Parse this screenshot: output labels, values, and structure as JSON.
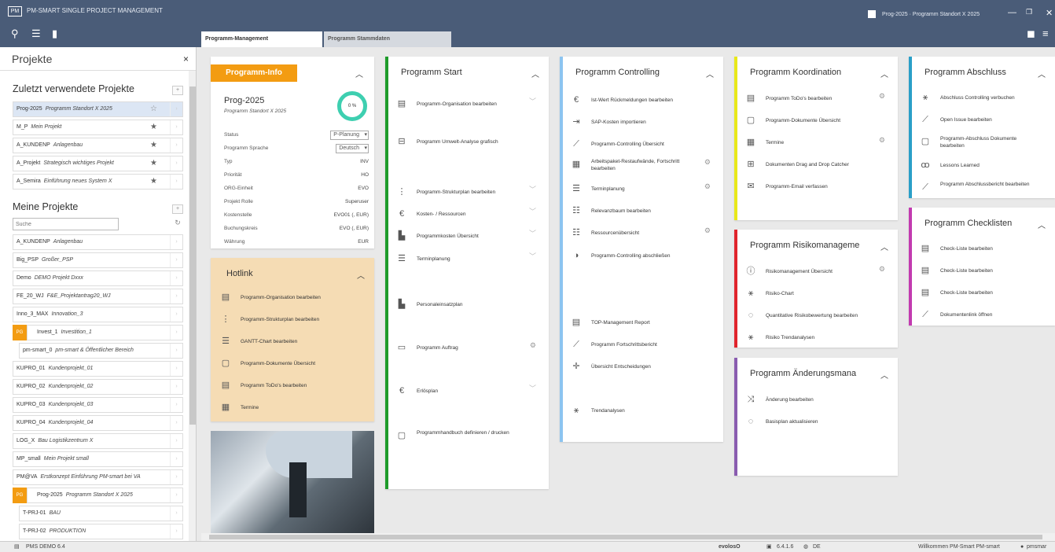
{
  "app": {
    "logo": "PM",
    "title": "PM-SMART SINGLE PROJECT MANAGEMENT",
    "current_project": "Prog-2025 · Programm Standort X 2025",
    "win_min": "—",
    "win_restore": "❐",
    "win_close": "✕"
  },
  "tabs": [
    {
      "label": "Programm-Management"
    },
    {
      "label": "Programm Stammdaten"
    }
  ],
  "sidebar": {
    "title": "Projekte",
    "close": "×",
    "recent_title": "Zuletzt verwendete Projekte",
    "recent": [
      {
        "code": "Prog-2025",
        "name": "Programm Standort X 2025"
      },
      {
        "code": "M_P",
        "name": "Mein Projekt"
      },
      {
        "code": "A_KUNDENP",
        "name": "Anlagenbau"
      },
      {
        "code": "A_Projekt",
        "name": "Strategisch wichtiges Projekt"
      },
      {
        "code": "A_Semira",
        "name": "Einführung neues System X"
      }
    ],
    "mine_title": "Meine Projekte",
    "search_placeholder": "Suche",
    "mine": [
      {
        "code": "A_KUNDENP",
        "name": "Anlagenbau"
      },
      {
        "code": "Big_PSP",
        "name": "Großer_PSP"
      },
      {
        "code": "Demo",
        "name": "DEMO Projekt Dxxx"
      },
      {
        "code": "FE_20_WJ",
        "name": "F&E_Projektantrag20_WJ"
      },
      {
        "code": "Inno_3_MAX",
        "name": "Innovation_3"
      },
      {
        "code": "Invest_1",
        "name": "Investition_1"
      },
      {
        "code": "pm-smart_0",
        "name": "pm-smart & Öffentlicher Bereich"
      },
      {
        "code": "KUPRO_01",
        "name": "Kundenprojekt_01"
      },
      {
        "code": "KUPRO_02",
        "name": "Kundenprojekt_02"
      },
      {
        "code": "KUPRO_03",
        "name": "Kundenprojekt_03"
      },
      {
        "code": "KUPRO_04",
        "name": "Kundenprojekt_04"
      },
      {
        "code": "LOG_X",
        "name": "Bau Logistikzentrum X"
      },
      {
        "code": "MP_small",
        "name": "Mein Projekt small"
      },
      {
        "code": "PM@VA",
        "name": "Erstkonzept Einführung PM-smart bei VA"
      },
      {
        "code": "Prog-2025",
        "name": "Programm Standort X 2025"
      },
      {
        "code": "T-PRJ-01",
        "name": "BAU"
      },
      {
        "code": "T-PRJ-02",
        "name": "PRODUKTION"
      }
    ],
    "flag": "PG"
  },
  "info": {
    "banner": "Programm-Info",
    "code": "Prog-2025",
    "name": "Programm Standort X 2025",
    "percent": "0 %",
    "fields": [
      {
        "k": "Status",
        "v": "P-Planung"
      },
      {
        "k": "Programm Sprache",
        "v": "Deutsch"
      },
      {
        "k": "Typ",
        "v": "INV"
      },
      {
        "k": "Priorität",
        "v": "HO"
      },
      {
        "k": "ORG-Einheit",
        "v": "EVO"
      },
      {
        "k": "Projekt Rolle",
        "v": "Superuser"
      },
      {
        "k": "Kostenstelle",
        "v": "EVO01 (, EUR)"
      },
      {
        "k": "Buchungskreis",
        "v": "EVO (, EUR)"
      },
      {
        "k": "Währung",
        "v": "EUR"
      }
    ]
  },
  "hotlink": {
    "title": "Hotlink",
    "items": [
      "Programm-Organisation bearbeiten",
      "Programm-Strukturplan bearbeiten",
      "GANTT-Chart bearbeiten",
      "Programm-Dokumente Übersicht",
      "Programm ToDo's bearbeiten",
      "Termine"
    ]
  },
  "start": {
    "title": "Programm Start",
    "items": [
      "Programm-Organisation bearbeiten",
      "Programm Umwelt-Analyse grafisch",
      "Programm-Strukturplan bearbeiten",
      "Kosten- / Ressourcen",
      "Programmkosten Übersicht",
      "Terminplanung",
      "Personaleinsatzplan",
      "Programm Auftrag",
      "Erlösplan",
      "Programmhandbuch definieren / drucken"
    ]
  },
  "controlling": {
    "title": "Programm Controlling",
    "items": [
      "Ist-Wert Rückmeldungen bearbeiten",
      "SAP-Kosten importieren",
      "Programm-Controlling Übersicht",
      "Arbeitspaket-Restaufwände, Fortschritt bearbeiten",
      "Terminplanung",
      "Relevanzbaum bearbeiten",
      "Ressourcenübersicht",
      "Programm-Controlling abschließen",
      "TOP-Management Report",
      "Programm Fortschrittsbericht",
      "Übersicht Entscheidungen",
      "Trendanalysen"
    ]
  },
  "koordination": {
    "title": "Programm Koordination",
    "items": [
      "Programm ToDo's bearbeiten",
      "Programm-Dokumente Übersicht",
      "Termine",
      "Dokumenten Drag and Drop Catcher",
      "Programm-Email verfassen"
    ]
  },
  "risiko": {
    "title": "Programm Risikomanageme",
    "items": [
      "Risikomanagement Übersicht",
      "Risiko-Chart",
      "Quantitative Risikobewertung bearbeiten",
      "Risiko Trendanalysen"
    ]
  },
  "aenderung": {
    "title": "Programm Änderungsmana",
    "items": [
      "Änderung bearbeiten",
      "Basisplan aktualisieren"
    ]
  },
  "abschluss": {
    "title": "Programm Abschluss",
    "items": [
      "Abschluss Controlling verbuchen",
      "Open Issue bearbeiten",
      "Programm-Abschluss Dokumente bearbeiten",
      "Lessons Learned",
      "Programm Abschlussbericht bearbeiten"
    ]
  },
  "checklisten": {
    "title": "Programm Checklisten",
    "items": [
      "Check-Liste bearbeiten",
      "Check-Liste bearbeiten",
      "Check-Liste bearbeiten",
      "Dokumentenlink öffnen"
    ]
  },
  "status": {
    "db": "PMS DEMO 6.4",
    "brand": "evolosO",
    "version": "6.4.1.6",
    "lang": "DE",
    "welcome": "Willkommen PM-Smart PM-smart",
    "user": "pmsmar"
  },
  "colors": {
    "accent_orange": "#f39c12",
    "start": "#1e9b2a",
    "controlling": "#8cc4f0",
    "koordination": "#e8e81a",
    "risiko": "#e0242c",
    "aenderung": "#8a5cb0",
    "abschluss": "#2a9fc8",
    "checklisten": "#c23ab0"
  }
}
